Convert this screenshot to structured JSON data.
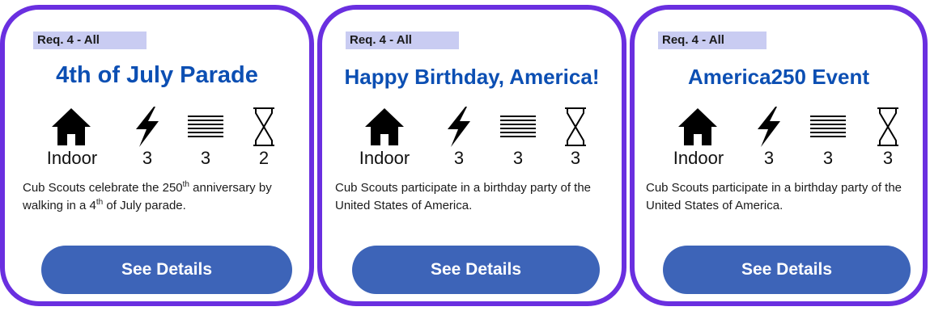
{
  "cards": [
    {
      "req_label": "Req. 4 - All",
      "title": "4th of July Parade",
      "location": "Indoor",
      "energy": "3",
      "supplies": "3",
      "prep_time": "2",
      "description_part1": "Cub Scouts celebrate the 250",
      "description_sup1": "th",
      "description_part2": " anniversary by walking in a 4",
      "description_sup2": "th",
      "description_part3": " of July parade.",
      "button_label": "See Details"
    },
    {
      "req_label": "Req. 4 - All",
      "title": "Happy Birthday, America!",
      "location": "Indoor",
      "energy": "3",
      "supplies": "3",
      "prep_time": "3",
      "description": "Cub Scouts participate in a birthday party of the United States of America.",
      "button_label": "See Details"
    },
    {
      "req_label": "Req. 4 - All",
      "title": "America250 Event",
      "location": "Indoor",
      "energy": "3",
      "supplies": "3",
      "prep_time": "3",
      "description": "Cub Scouts participate in a birthday party of the United States of America.",
      "button_label": "See Details"
    }
  ],
  "icons": {
    "location": "house-icon",
    "energy": "lightning-bolt-icon",
    "supplies": "lines-list-icon",
    "prep_time": "hourglass-icon"
  },
  "colors": {
    "card_border": "#6a2fe0",
    "title": "#0c4fb3",
    "badge_bg": "#c9ccf2",
    "button_bg": "#3d64b8",
    "button_text": "#ffffff"
  }
}
